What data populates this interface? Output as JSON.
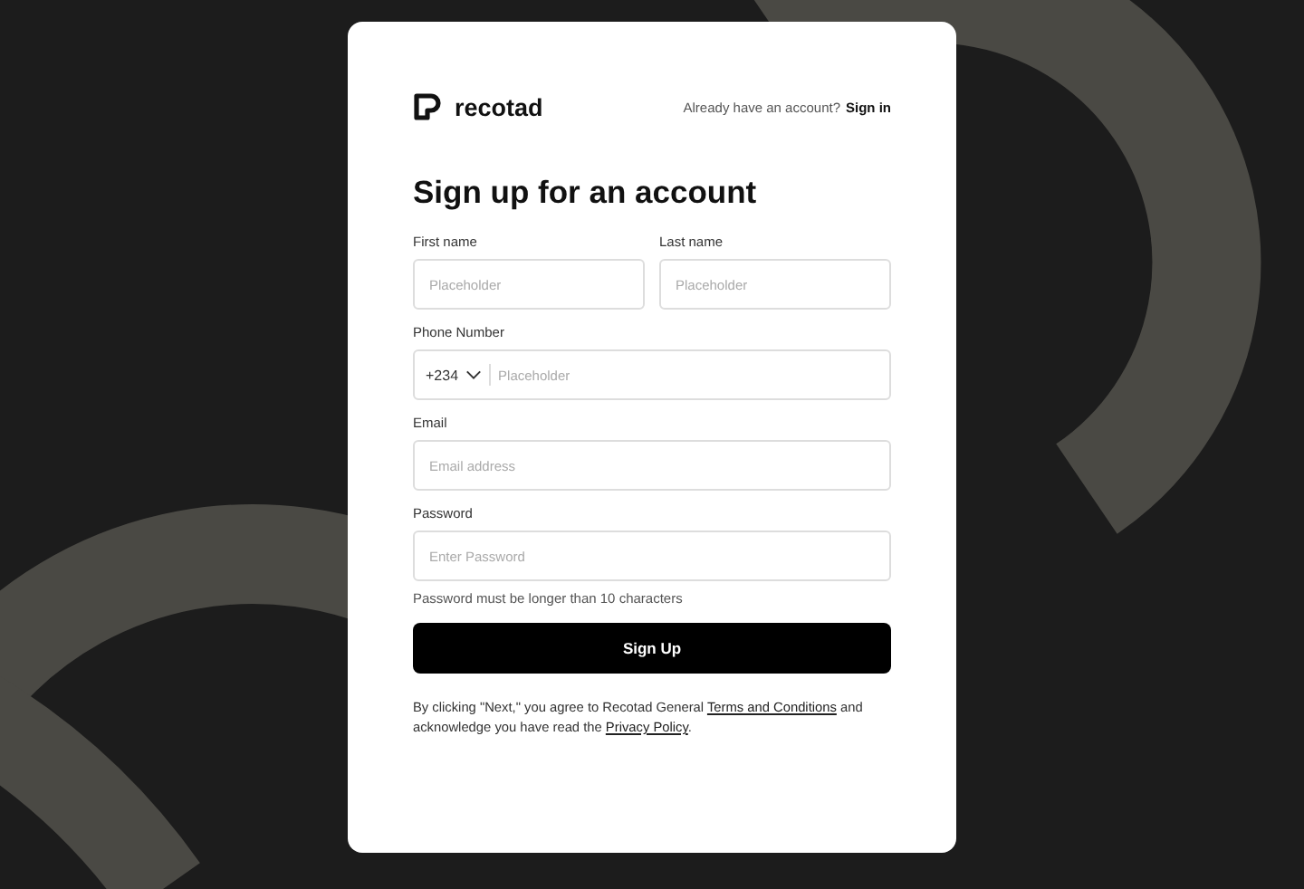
{
  "brand": {
    "name": "recotad"
  },
  "signin_prompt": {
    "text": "Already have an account?",
    "link": "Sign in"
  },
  "title": "Sign up for an account",
  "name_fields": [
    {
      "label": "First name",
      "placeholder": "Placeholder"
    },
    {
      "label": "Last name",
      "placeholder": "Placeholder"
    }
  ],
  "phone": {
    "label": "Phone Number",
    "country_code": "+234",
    "placeholder": "Placeholder"
  },
  "email": {
    "label": "Email",
    "placeholder": "Email address"
  },
  "password": {
    "label": "Password",
    "placeholder": "Enter Password",
    "hint": "Password must be longer than 10 characters"
  },
  "submit": "Sign Up",
  "legal": {
    "before": "By clicking \"Next,\" you agree to Recotad General",
    "terms_link": "Terms and Conditions",
    "middle": "and acknowledge you have read the",
    "privacy_link": "Privacy Policy",
    "after": "."
  }
}
